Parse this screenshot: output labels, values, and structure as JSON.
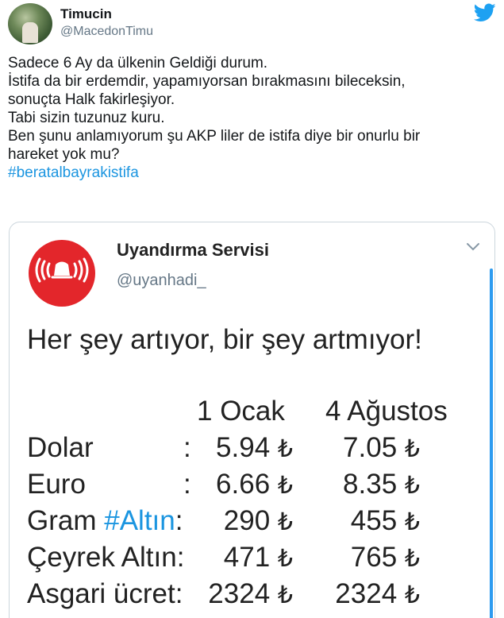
{
  "tweet": {
    "author": {
      "display_name": "Timucin",
      "handle": "@MacedonTimu"
    },
    "lines": [
      "Sadece 6 Ay da ülkenin Geldiği durum.",
      "İstifa da bir erdemdir, yapamıyorsan bırakmasını bileceksin,",
      "sonuçta Halk fakirleşiyor.",
      "Tabi sizin tuzunuz kuru.",
      "Ben şunu anlamıyorum şu AKP liler de istifa diye bir onurlu bir",
      "hareket yok mu?"
    ],
    "hashtag": "#beratalbayrakistifa"
  },
  "quoted_tweet": {
    "author": {
      "display_name": "Uyandırma Servisi",
      "handle": "@uyanhadi_"
    },
    "headline": "Her şey artıyor, bir şey artmıyor!",
    "columns": {
      "col1": "1 Ocak",
      "col2": "4 Ağustos"
    },
    "currency_symbol": "₺",
    "rows": [
      {
        "label": "Dolar",
        "colon": ":",
        "v1": "5.94",
        "v2": "7.05"
      },
      {
        "label": "Euro",
        "colon": ":",
        "v1": "6.66",
        "v2": "8.35"
      },
      {
        "label_prefix": "Gram ",
        "label_hashtag": "#Altın",
        "label_suffix": ":",
        "v1": "290",
        "v2": "455"
      },
      {
        "label": "Çeyrek Altın:",
        "v1": "471",
        "v2": "765"
      },
      {
        "label": "Asgari ücret:",
        "v1": "2324",
        "v2": "2324"
      }
    ]
  },
  "icons": {
    "platform_logo": "twitter-bird-icon",
    "quote_avatar": "alarm-bell-icon",
    "menu": "chevron-down-icon"
  },
  "colors": {
    "accent": "#1b95e0",
    "avatar_red": "#e3262b",
    "muted": "#657786"
  }
}
